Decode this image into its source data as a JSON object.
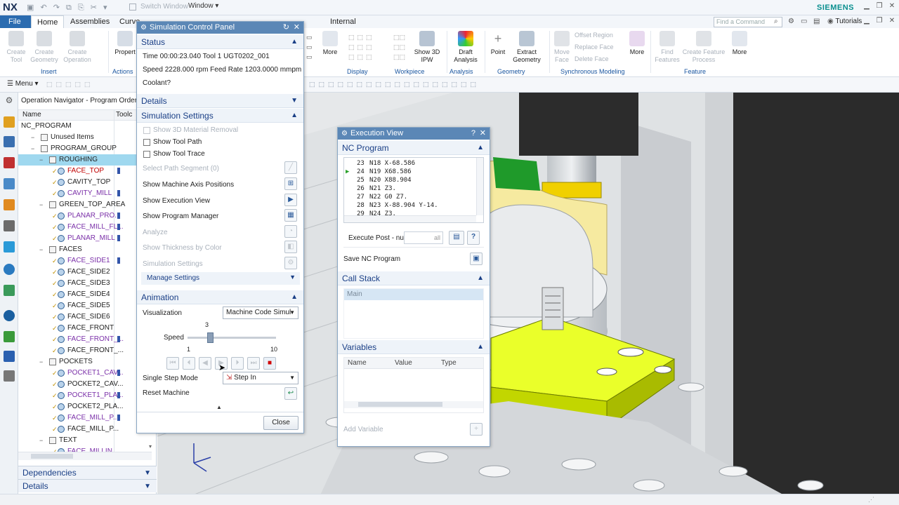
{
  "app": {
    "logo": "NX",
    "switch_window": "Switch Window",
    "window_menu": "Window ▾",
    "brand": "SIEMENS",
    "tutorials": "Tutorials",
    "find_placeholder": "Find a Command"
  },
  "ribbon_tabs": [
    "File",
    "Home",
    "Assemblies",
    "Curve",
    "Internal"
  ],
  "ribbon": {
    "insert": [
      "Create Tool",
      "Create Geometry",
      "Create Operation"
    ],
    "insert_group": "Insert",
    "actions_btn": "Propert",
    "actions_group": "Actions",
    "partial_more": "More",
    "display_group": "Display",
    "workpiece_btn": "Show 3D IPW",
    "workpiece_group": "Workpiece",
    "draft_btn": "Draft Analysis",
    "analysis_group": "Analysis",
    "point_btn": "Point",
    "extract_btn": "Extract Geometry",
    "geometry_group": "Geometry",
    "move_face": "Move Face",
    "offset_region": "Offset Region",
    "replace_face": "Replace Face",
    "delete_face": "Delete Face",
    "more_btn": "More",
    "sync_group": "Synchronous Modeling",
    "find_features": "Find Features",
    "create_feature_process": "Create Feature Process",
    "more_btn2": "More",
    "feature_group": "Feature"
  },
  "menu_label": "Menu ▾",
  "navigator": {
    "title": "Operation Navigator - Program Order",
    "col_name": "Name",
    "col_tool": "Toolc",
    "items": [
      {
        "label": "NC_PROGRAM",
        "level": 0,
        "color": "#222"
      },
      {
        "label": "Unused Items",
        "level": 1,
        "color": "#222"
      },
      {
        "label": "PROGRAM_GROUP",
        "level": 1,
        "color": "#222"
      },
      {
        "label": "ROUGHING",
        "level": 2,
        "color": "#222",
        "selected": true
      },
      {
        "label": "FACE_TOP",
        "level": 3,
        "color": "#c00000",
        "bar": true
      },
      {
        "label": "CAVITY_TOP",
        "level": 3,
        "color": "#222"
      },
      {
        "label": "CAVITY_MILL",
        "level": 3,
        "color": "#7a2fa8",
        "bar": true
      },
      {
        "label": "GREEN_TOP_AREA",
        "level": 2,
        "color": "#222"
      },
      {
        "label": "PLANAR_PRO...",
        "level": 3,
        "color": "#7a2fa8",
        "bar": true
      },
      {
        "label": "FACE_MILL_FL...",
        "level": 3,
        "color": "#7a2fa8",
        "bar": true
      },
      {
        "label": "PLANAR_MILL",
        "level": 3,
        "color": "#7a2fa8",
        "bar": true
      },
      {
        "label": "FACES",
        "level": 2,
        "color": "#222"
      },
      {
        "label": "FACE_SIDE1",
        "level": 3,
        "color": "#7a2fa8",
        "bar": true
      },
      {
        "label": "FACE_SIDE2",
        "level": 3,
        "color": "#222"
      },
      {
        "label": "FACE_SIDE3",
        "level": 3,
        "color": "#222"
      },
      {
        "label": "FACE_SIDE4",
        "level": 3,
        "color": "#222"
      },
      {
        "label": "FACE_SIDE5",
        "level": 3,
        "color": "#222"
      },
      {
        "label": "FACE_SIDE6",
        "level": 3,
        "color": "#222"
      },
      {
        "label": "FACE_FRONT",
        "level": 3,
        "color": "#222"
      },
      {
        "label": "FACE_FRONT_...",
        "level": 3,
        "color": "#7a2fa8",
        "bar": true
      },
      {
        "label": "FACE_FRONT_...",
        "level": 3,
        "color": "#222"
      },
      {
        "label": "POCKETS",
        "level": 2,
        "color": "#222"
      },
      {
        "label": "POCKET1_CAV...",
        "level": 3,
        "color": "#7a2fa8",
        "bar": true
      },
      {
        "label": "POCKET2_CAV...",
        "level": 3,
        "color": "#222"
      },
      {
        "label": "POCKET1_PLA...",
        "level": 3,
        "color": "#7a2fa8",
        "bar": true
      },
      {
        "label": "POCKET2_PLA...",
        "level": 3,
        "color": "#222"
      },
      {
        "label": "FACE_MILL_P...",
        "level": 3,
        "color": "#7a2fa8",
        "bar": true
      },
      {
        "label": "FACE_MILL_P...",
        "level": 3,
        "color": "#222"
      },
      {
        "label": "TEXT",
        "level": 2,
        "color": "#222"
      },
      {
        "label": "FACE_MILLIN...",
        "level": 3,
        "color": "#7a2fa8"
      }
    ],
    "dependencies": "Dependencies",
    "details": "Details"
  },
  "sim_panel": {
    "title": "Simulation Control Panel",
    "status_head": "Status",
    "status_line1": "Time 00:00:23.040    Tool 1   UGT0202_001",
    "status_line2": "Speed 2228.000 rpm Feed Rate 1203.0000 mmpm",
    "status_line3": "Coolant?",
    "details_head": "Details",
    "settings_head": "Simulation Settings",
    "opt_3d": "Show 3D Material Removal",
    "opt_toolpath": "Show Tool Path",
    "opt_trace": "Show Tool Trace",
    "select_segment": "Select Path Segment (0)",
    "machine_axis": "Show Machine Axis Positions",
    "exec_view": "Show Execution View",
    "prog_manager": "Show Program Manager",
    "analyze": "Analyze",
    "thickness": "Show Thickness by Color",
    "sim_settings": "Simulation Settings",
    "manage": "Manage Settings",
    "anim_head": "Animation",
    "visualization_label": "Visualization",
    "visualization_value": "Machine Code Simul",
    "speed_label": "Speed",
    "speed_value": "3",
    "speed_min": "1",
    "speed_max": "10",
    "speed_fraction": 0.22,
    "step_label": "Single Step Mode",
    "step_value": "Step In",
    "reset_label": "Reset Machine",
    "close": "Close"
  },
  "exec_view": {
    "title": "Execution View",
    "nc_head": "NC Program",
    "lines": [
      {
        "num": "23",
        "code": "N18 X-68.586",
        "current": false
      },
      {
        "num": "24",
        "code": "N19 X68.586",
        "current": true
      },
      {
        "num": "25",
        "code": "N20 X88.904",
        "current": false
      },
      {
        "num": "26",
        "code": "N21 Z3.",
        "current": false
      },
      {
        "num": "27",
        "code": "N22 G0 Z7.",
        "current": false
      },
      {
        "num": "28",
        "code": "N23 X-88.904 Y-14.",
        "current": false
      },
      {
        "num": "29",
        "code": "N24 Z3.",
        "current": false
      }
    ],
    "execute_post": "Execute Post - nu",
    "execute_field": "all",
    "save": "Save NC Program",
    "callstack_head": "Call Stack",
    "callstack_item": "Main",
    "vars_head": "Variables",
    "col_name": "Name",
    "col_value": "Value",
    "col_type": "Type",
    "add_var": "Add Variable"
  }
}
